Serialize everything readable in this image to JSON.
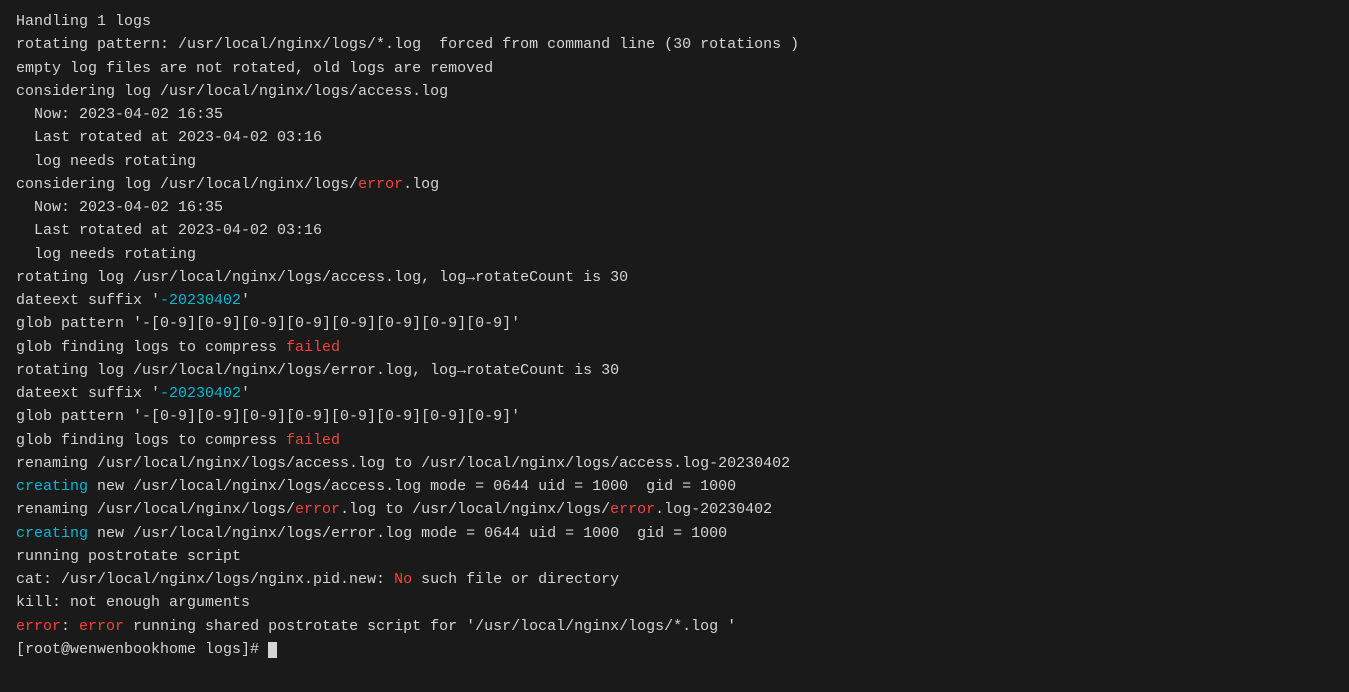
{
  "terminal": {
    "lines": [
      {
        "id": "line1",
        "parts": [
          {
            "text": "Handling 1 logs",
            "color": "white"
          }
        ]
      },
      {
        "id": "line2",
        "parts": []
      },
      {
        "id": "line3",
        "parts": [
          {
            "text": "rotating pattern: /usr/local/nginx/logs/*.log  forced from command line (30 rotations )",
            "color": "white"
          }
        ]
      },
      {
        "id": "line4",
        "parts": [
          {
            "text": "empty log files are not rotated, old logs are removed",
            "color": "white"
          }
        ]
      },
      {
        "id": "line5",
        "parts": [
          {
            "text": "considering log /usr/local/nginx/logs/access.log",
            "color": "white"
          }
        ]
      },
      {
        "id": "line6",
        "parts": [
          {
            "text": "  Now: 2023-04-02 16:35",
            "color": "white"
          }
        ]
      },
      {
        "id": "line7",
        "parts": [
          {
            "text": "  Last rotated at 2023-04-02 03:16",
            "color": "white"
          }
        ]
      },
      {
        "id": "line8",
        "parts": [
          {
            "text": "  log needs rotating",
            "color": "white"
          }
        ]
      },
      {
        "id": "line9",
        "parts": [
          {
            "text": "considering log /usr/local/nginx/logs/",
            "color": "white"
          },
          {
            "text": "error",
            "color": "red"
          },
          {
            "text": ".log",
            "color": "white"
          }
        ]
      },
      {
        "id": "line10",
        "parts": [
          {
            "text": "  Now: 2023-04-02 16:35",
            "color": "white"
          }
        ]
      },
      {
        "id": "line11",
        "parts": [
          {
            "text": "  Last rotated at 2023-04-02 03:16",
            "color": "white"
          }
        ]
      },
      {
        "id": "line12",
        "parts": [
          {
            "text": "  log needs rotating",
            "color": "white"
          }
        ]
      },
      {
        "id": "line13",
        "parts": [
          {
            "text": "rotating log /usr/local/nginx/logs/access.log, log→rotateCount is 30",
            "color": "white"
          }
        ]
      },
      {
        "id": "line14",
        "parts": [
          {
            "text": "dateext suffix '",
            "color": "white"
          },
          {
            "text": "-20230402",
            "color": "cyan"
          },
          {
            "text": "'",
            "color": "white"
          }
        ]
      },
      {
        "id": "line15",
        "parts": [
          {
            "text": "glob pattern '-[0-9][0-9][0-9][0-9][0-9][0-9][0-9][0-9]'",
            "color": "white"
          }
        ]
      },
      {
        "id": "line16",
        "parts": [
          {
            "text": "glob finding logs to compress ",
            "color": "white"
          },
          {
            "text": "failed",
            "color": "red"
          }
        ]
      },
      {
        "id": "line17",
        "parts": [
          {
            "text": "rotating log /usr/local/nginx/logs/error.log, log→rotateCount is 30",
            "color": "white"
          }
        ]
      },
      {
        "id": "line18",
        "parts": [
          {
            "text": "dateext suffix '",
            "color": "white"
          },
          {
            "text": "-20230402",
            "color": "cyan"
          },
          {
            "text": "'",
            "color": "white"
          }
        ]
      },
      {
        "id": "line19",
        "parts": [
          {
            "text": "glob pattern '-[0-9][0-9][0-9][0-9][0-9][0-9][0-9][0-9]'",
            "color": "white"
          }
        ]
      },
      {
        "id": "line20",
        "parts": [
          {
            "text": "glob finding logs to compress ",
            "color": "white"
          },
          {
            "text": "failed",
            "color": "red"
          }
        ]
      },
      {
        "id": "line21",
        "parts": [
          {
            "text": "renaming /usr/local/nginx/logs/access.log to /usr/local/nginx/logs/access.log-20230402",
            "color": "white"
          }
        ]
      },
      {
        "id": "line22",
        "parts": [
          {
            "text": "creating",
            "color": "cyan"
          },
          {
            "text": " new /usr/local/nginx/logs/access.log mode = 0644 uid = 1000  gid = 1000",
            "color": "white"
          }
        ]
      },
      {
        "id": "line23",
        "parts": [
          {
            "text": "renaming /usr/local/nginx/logs/",
            "color": "white"
          },
          {
            "text": "error",
            "color": "red"
          },
          {
            "text": ".log to /usr/local/nginx/logs/",
            "color": "white"
          },
          {
            "text": "error",
            "color": "red"
          },
          {
            "text": ".log-20230402",
            "color": "white"
          }
        ]
      },
      {
        "id": "line24",
        "parts": [
          {
            "text": "creating",
            "color": "cyan"
          },
          {
            "text": " new /usr/local/nginx/logs/error.log mode = 0644 uid = 1000  gid = 1000",
            "color": "white"
          }
        ]
      },
      {
        "id": "line25",
        "parts": [
          {
            "text": "running postrotate script",
            "color": "white"
          }
        ]
      },
      {
        "id": "line26",
        "parts": [
          {
            "text": "cat: /usr/local/nginx/logs/nginx.pid.new: ",
            "color": "white"
          },
          {
            "text": "No",
            "color": "red"
          },
          {
            "text": " such file or directory",
            "color": "white"
          }
        ]
      },
      {
        "id": "line27",
        "parts": [
          {
            "text": "kill: not enough arguments",
            "color": "white"
          }
        ]
      },
      {
        "id": "line28",
        "parts": [
          {
            "text": "error",
            "color": "red"
          },
          {
            "text": ": ",
            "color": "white"
          },
          {
            "text": "error",
            "color": "red"
          },
          {
            "text": " running shared postrotate script for '/usr/local/nginx/logs/*.log '",
            "color": "white"
          }
        ]
      },
      {
        "id": "line29",
        "parts": [
          {
            "text": "[root@wenwenbookhome logs]# ",
            "color": "white"
          }
        ],
        "cursor": true
      }
    ]
  }
}
